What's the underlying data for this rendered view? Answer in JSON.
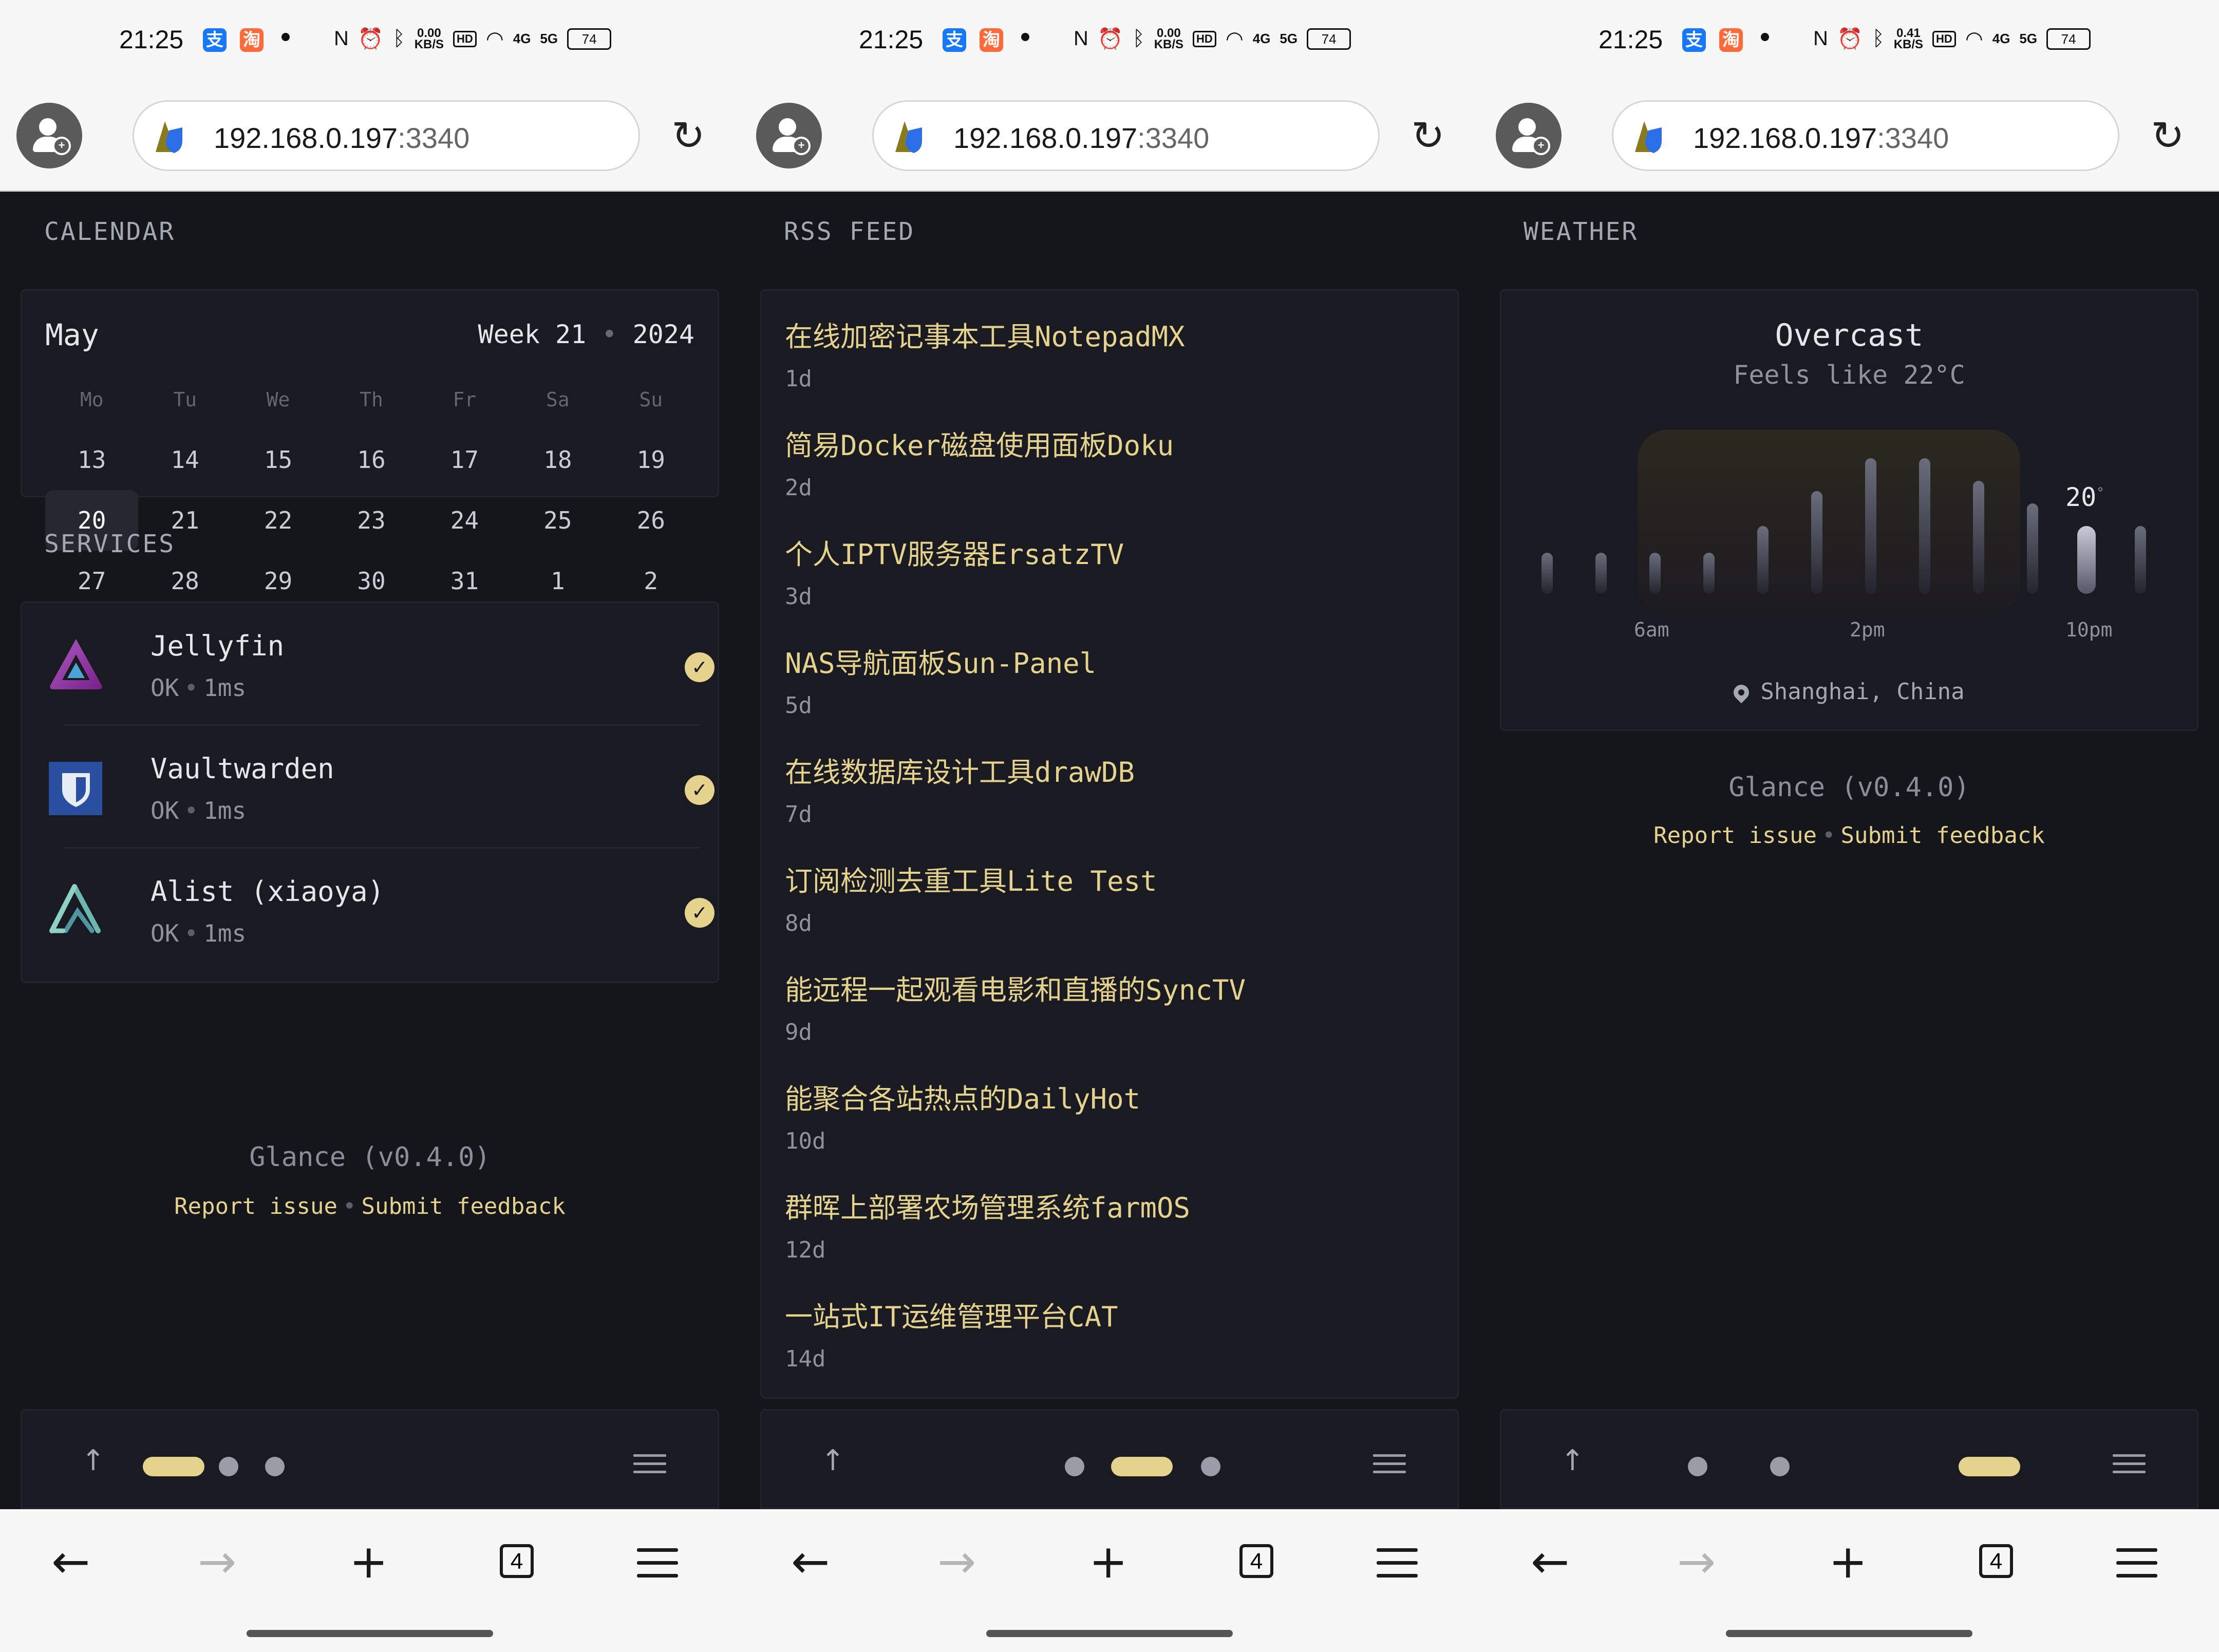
{
  "status_bar": {
    "time": "21:25",
    "net_screen1": "0.00",
    "net_screen2": "0.00",
    "net_screen3": "0.41",
    "net_unit": "KB/S",
    "hd": "HD",
    "sig4g": "4G",
    "sig5g": "5G",
    "battery": "74"
  },
  "url_bar": {
    "host": "192.168.0.197",
    "port": ":3340"
  },
  "calendar": {
    "section_title": "CALENDAR",
    "month": "May",
    "week_label": "Week 21",
    "year": "2024",
    "weekdays": [
      "Mo",
      "Tu",
      "We",
      "Th",
      "Fr",
      "Sa",
      "Su"
    ],
    "rows": [
      [
        "13",
        "14",
        "15",
        "16",
        "17",
        "18",
        "19"
      ],
      [
        "20",
        "21",
        "22",
        "23",
        "24",
        "25",
        "26"
      ],
      [
        "27",
        "28",
        "29",
        "30",
        "31",
        "1",
        "2"
      ]
    ],
    "today": "20"
  },
  "services": {
    "section_title": "SERVICES",
    "items": [
      {
        "name": "Jellyfin",
        "status": "OK",
        "latency": "1ms"
      },
      {
        "name": "Vaultwarden",
        "status": "OK",
        "latency": "1ms"
      },
      {
        "name": "Alist (xiaoya)",
        "status": "OK",
        "latency": "1ms"
      }
    ]
  },
  "footer": {
    "version": "Glance (v0.4.0)",
    "report": "Report issue",
    "feedback": "Submit feedback"
  },
  "rss": {
    "section_title": "RSS FEED",
    "items": [
      {
        "title": "在线加密记事本工具NotepadMX",
        "age": "1d"
      },
      {
        "title": "简易Docker磁盘使用面板Doku",
        "age": "2d"
      },
      {
        "title": "个人IPTV服务器ErsatzTV",
        "age": "3d"
      },
      {
        "title": "NAS导航面板Sun-Panel",
        "age": "5d"
      },
      {
        "title": "在线数据库设计工具drawDB",
        "age": "7d"
      },
      {
        "title": "订阅检测去重工具Lite Test",
        "age": "8d"
      },
      {
        "title": "能远程一起观看电影和直播的SyncTV",
        "age": "9d"
      },
      {
        "title": "能聚合各站热点的DailyHot",
        "age": "10d"
      },
      {
        "title": "群晖上部署农场管理系统farmOS",
        "age": "12d"
      },
      {
        "title": "一站式IT运维管理平台CAT",
        "age": "14d"
      }
    ]
  },
  "weather": {
    "section_title": "WEATHER",
    "condition": "Overcast",
    "feels_like": "Feels like 22°C",
    "current_temp": "20",
    "degree": "°",
    "ticks": [
      "6am",
      "2pm",
      "10pm"
    ],
    "location": "Shanghai, China",
    "bar_levels": [
      0.2,
      0.2,
      0.2,
      0.2,
      0.33,
      0.5,
      0.66,
      0.66,
      0.55,
      0.44,
      0.33,
      0.33
    ],
    "current_index": 10
  },
  "nav": {
    "tabs_count": "4"
  },
  "colors": {
    "accent": "#e4d28d",
    "background": "#15161c",
    "card": "#1a1b22"
  }
}
